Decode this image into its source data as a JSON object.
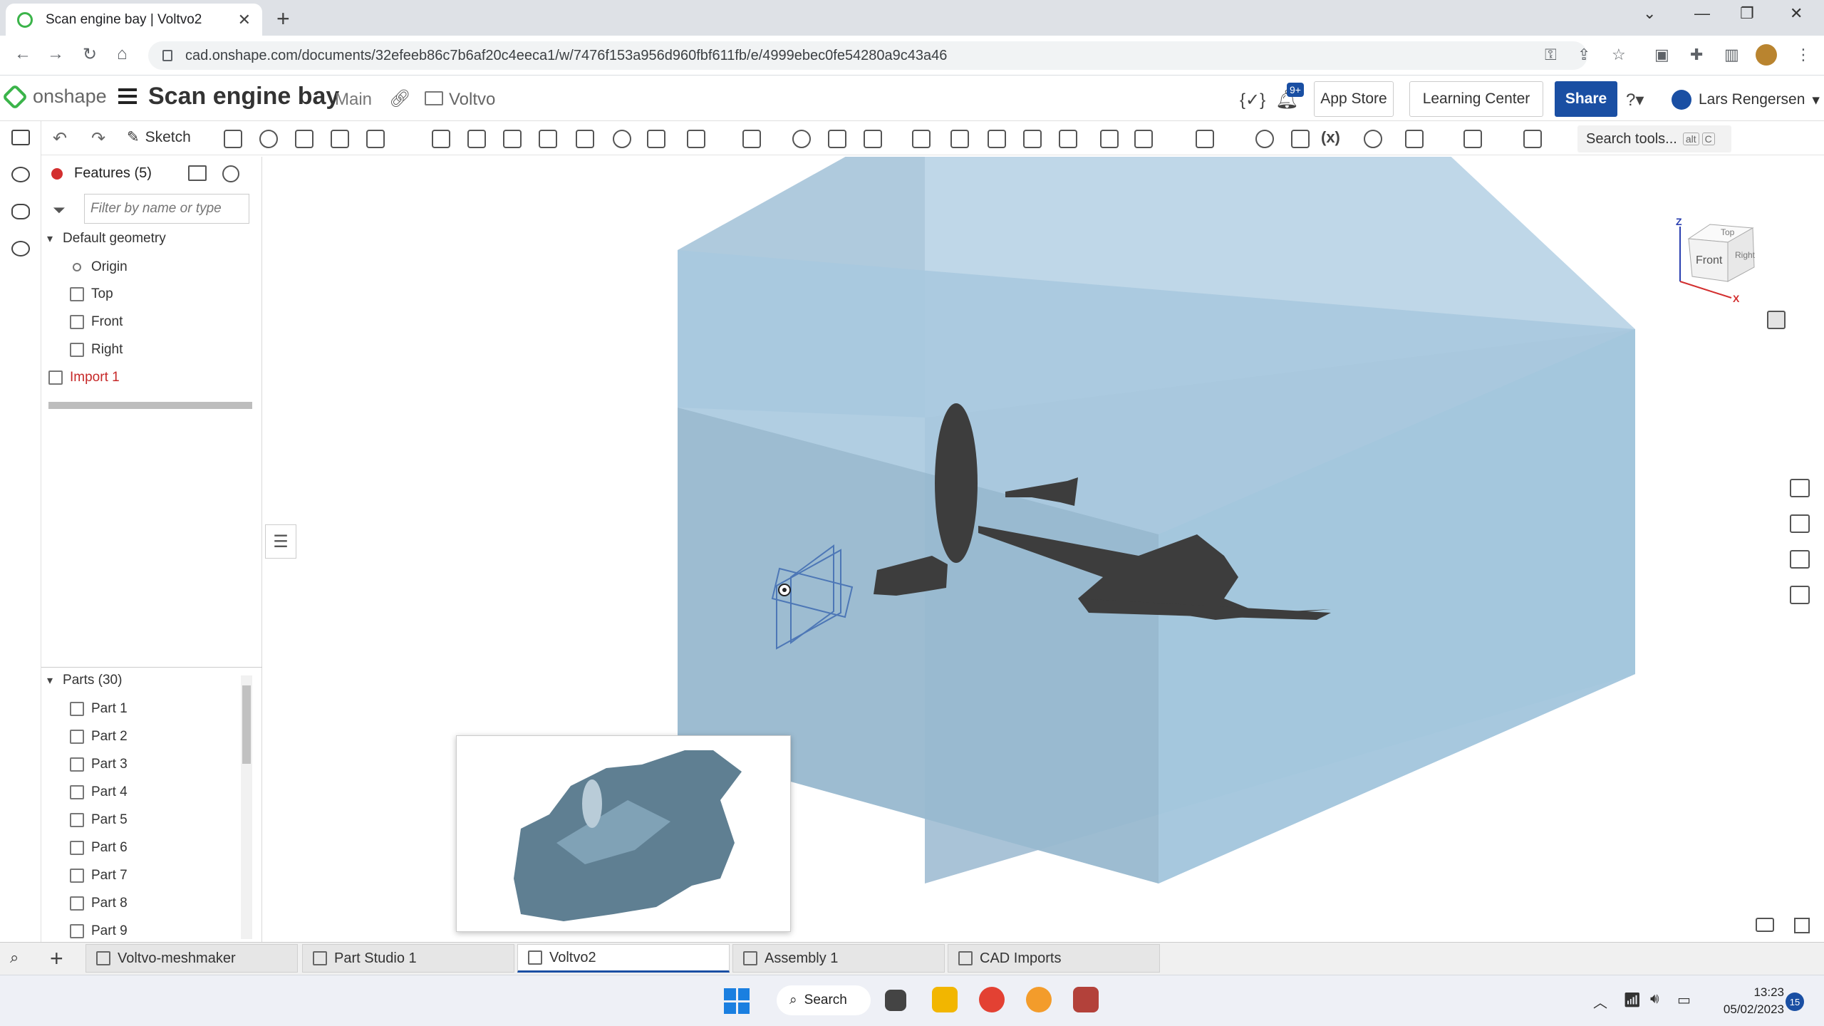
{
  "browser": {
    "tab_title": "Scan engine bay | Voltvo2",
    "url": "cad.onshape.com/documents/32efeeb86c7b6af20c4eeca1/w/7476f153a956d960fbf611fb/e/4999ebec0fe54280a9c43a46"
  },
  "header": {
    "logo_text": "onshape",
    "doc_title": "Scan engine bay",
    "branch": "Main",
    "folder": "Voltvo",
    "notif_badge": "9+",
    "app_store": "App Store",
    "learning_center": "Learning Center",
    "share": "Share",
    "user": "Lars Rengersen"
  },
  "toolbar": {
    "sketch_label": "Sketch",
    "search_tools": "Search tools...",
    "search_shortcut_alt": "alt",
    "search_shortcut_key": "C"
  },
  "features": {
    "title": "Features (5)",
    "filter_placeholder": "Filter by name or type",
    "default_geometry": "Default geometry",
    "items": [
      "Origin",
      "Top",
      "Front",
      "Right"
    ],
    "import": "Import 1"
  },
  "parts": {
    "title": "Parts (30)",
    "items": [
      "Part 1",
      "Part 2",
      "Part 3",
      "Part 4",
      "Part 5",
      "Part 6",
      "Part 7",
      "Part 8",
      "Part 9"
    ]
  },
  "viewcube": {
    "top": "Top",
    "front": "Front",
    "right": "Right",
    "axis_z": "Z",
    "axis_x": "X"
  },
  "tabs": [
    {
      "label": "Voltvo-meshmaker"
    },
    {
      "label": "Part Studio 1"
    },
    {
      "label": "Voltvo2"
    },
    {
      "label": "Assembly 1"
    },
    {
      "label": "CAD Imports"
    }
  ],
  "taskbar": {
    "search": "Search",
    "time": "13:23",
    "date": "05/02/2023",
    "notifications": "15"
  },
  "colors": {
    "accent": "#1a4fa3",
    "box": "#a9c9df",
    "mesh": "#3d3d3d",
    "error": "#c62828"
  }
}
